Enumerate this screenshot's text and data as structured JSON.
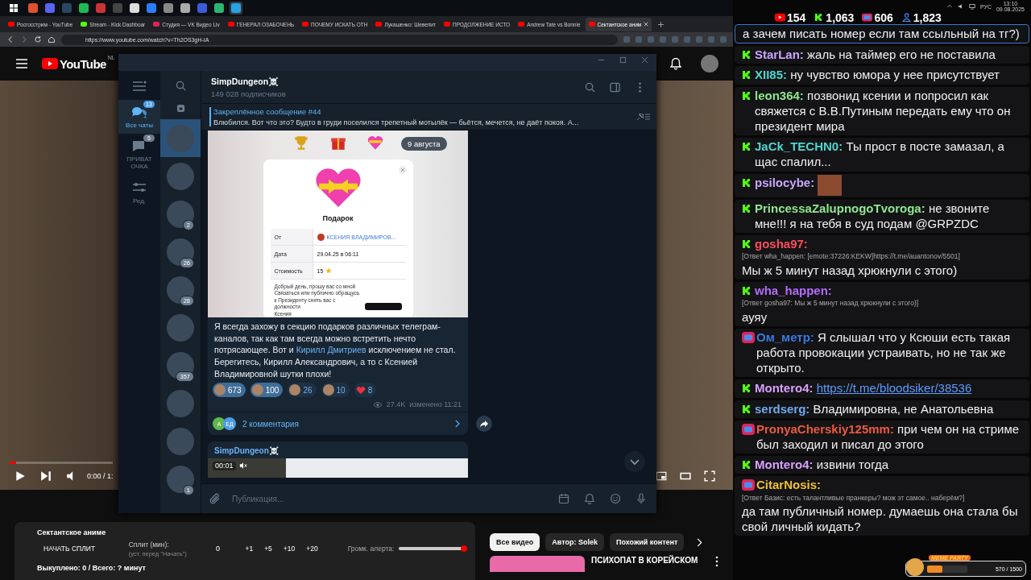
{
  "system_tray": {
    "language": "РУС",
    "time": "13:10",
    "date": "09.08.2025"
  },
  "browser": {
    "tabs": [
      {
        "title": "Росгосстрим - YouTube",
        "kind": "youtube",
        "selected": false
      },
      {
        "title": "Stream - Kick Dashboar",
        "kind": "kick",
        "selected": false
      },
      {
        "title": "Студия — VK Видео Liv",
        "kind": "vk",
        "selected": false
      },
      {
        "title": "ГЕНЕРАЛ ОЗАБОЧЕНЬ",
        "kind": "youtube",
        "selected": false
      },
      {
        "title": "ПОЧЕМУ ИСКАТЬ ОТН",
        "kind": "youtube",
        "selected": false
      },
      {
        "title": "Лукашенко: Шевелит",
        "kind": "youtube",
        "selected": false
      },
      {
        "title": "ПРОДОЛЖЕНИЕ ИСТО",
        "kind": "youtube",
        "selected": false
      },
      {
        "title": "Andrew Tate vs Bonnie",
        "kind": "youtube",
        "selected": false
      },
      {
        "title": "Сектантское аним",
        "kind": "youtube",
        "selected": true
      }
    ],
    "url": "https://www.youtube.com/watch?v=Th2OS3gH-IA"
  },
  "youtube": {
    "logo": "YouTube",
    "region": "NL",
    "video_time": "0:00 / 1:",
    "progress": {
      "level": 0.06
    },
    "chips": [
      {
        "label": "Все видео",
        "selected": true
      },
      {
        "label": "Автор: Solek",
        "selected": false
      },
      {
        "label": "Похожий контент",
        "selected": false
      }
    ],
    "recommended_title": "ПСИХОПАТ В КОРЕЙСКОМ"
  },
  "split_panel": {
    "title": "Сектантское аниме",
    "start_button": "НАЧАТЬ СПЛИТ",
    "split_label": "Сплит (мин):",
    "split_hint": "(уст. перед \"Начать\")",
    "split_value": "0",
    "increments": [
      "+1",
      "+5",
      "+10",
      "+20"
    ],
    "alert_label": "Громк. алерта:",
    "alert_volume": {
      "level": 0.95
    },
    "totals": "Выкуплено: 0 / Всего: ? минут"
  },
  "telegram": {
    "folders": [
      {
        "label": "Все чаты",
        "badge": "13",
        "kind": "chats",
        "selected": true
      },
      {
        "label": "ПРИВАТ ОЧКА",
        "badge": "5",
        "kind": "folder",
        "selected": false
      },
      {
        "label": "Ред.",
        "kind": "edit",
        "selected": false
      }
    ],
    "chats": [
      {
        "selected": true
      },
      {
        "selected": false
      },
      {
        "badge": "2",
        "selected": false
      },
      {
        "badge": "26",
        "selected": false
      },
      {
        "badge": "28",
        "selected": false
      },
      {
        "selected": false
      },
      {
        "badge": "357",
        "selected": false
      },
      {
        "selected": false
      },
      {
        "selected": false
      },
      {
        "badge": "1",
        "selected": false
      }
    ],
    "channel": {
      "name": "SimpDungeon☠️",
      "subscribers": "149 028 подписчиков"
    },
    "pinned": {
      "title": "Закреплённое сообщение #44",
      "text": "Влюбился.   Вот что это? Будто в груди поселился трепетный мотылёк — бьётся, мечется, не даёт покоя. А..."
    },
    "date": "9 августа",
    "gift": {
      "title": "Подарок",
      "rows": [
        {
          "label": "От",
          "value": "КСЕНИЯ ВЛАДИМИРОВ...",
          "kind": "user"
        },
        {
          "label": "Дата",
          "value": "29.04.25 в 06:11",
          "kind": "text"
        },
        {
          "label": "Стоимость",
          "value": "15",
          "kind": "stars"
        }
      ],
      "note": "Добрый день, прошу вас со мной Связаться или публично обращусь к Президенту снять вас с должности",
      "signature": "Ксения"
    },
    "post": {
      "text_before": "Я всегда захожу в секцию подарков различных телеграм-каналов, так как там всегда можно встретить нечто потрясающее. Вот и ",
      "link": "Кирилл Дмитриев",
      "text_after": " исключением не стал. Берегитесь, Кирилл Александрович, а то с Ксенией Владимировной шутки плохи!",
      "reactions": [
        {
          "count": "673",
          "kind": "emoji",
          "selected": true
        },
        {
          "count": "100",
          "kind": "emoji",
          "selected": true
        },
        {
          "count": "26",
          "kind": "emoji",
          "selected": false
        },
        {
          "count": "10",
          "kind": "emoji",
          "selected": false
        },
        {
          "count": "8",
          "kind": "heart",
          "selected": false
        }
      ],
      "views": "27.4K",
      "edited": "изменено 11:21",
      "commenters": [
        "А",
        "ЕД"
      ],
      "comments": "2 комментария"
    },
    "next_post": {
      "author": "SimpDungeon☠️",
      "video_time": "00:01"
    },
    "input_placeholder": "Публикация..."
  },
  "chat": {
    "counters": [
      {
        "kind": "youtube",
        "value": "154"
      },
      {
        "kind": "kick",
        "value": "1,063"
      },
      {
        "kind": "vk",
        "value": "606"
      },
      {
        "kind": "viewers",
        "value": "1,823"
      }
    ],
    "messages": [
      {
        "kind": "none",
        "highlighted": true,
        "text": "а зачем писать номер если там ссыльный на тг?)"
      },
      {
        "kind": "kick",
        "highlighted": false,
        "author": "StarLan:",
        "color": "#c9a6ff",
        "text": "жаль на таймер его не поставила"
      },
      {
        "kind": "kick",
        "highlighted": false,
        "author": "XII85:",
        "color": "#4fd6d0",
        "text": "ну чувство юмора у нее присутствует"
      },
      {
        "kind": "kick",
        "highlighted": false,
        "author": "leon364:",
        "color": "#8ee88e",
        "text": "позвонид ксении и попросил как свяжется с В.В.Путиным передать ему что он президент мира"
      },
      {
        "kind": "kick",
        "highlighted": false,
        "author": "JaCk_TECHN0:",
        "color": "#4fd6d0",
        "text": "Ты прост в посте замазал, а щас спалил..."
      },
      {
        "kind": "kick",
        "highlighted": false,
        "author": "psilocybe:",
        "color": "#c9a6ff",
        "emote": true
      },
      {
        "kind": "kick",
        "highlighted": false,
        "author": "PrincessaZalupnogoTvoroga:",
        "color": "#8ee88e",
        "text": "не звоните мне!!! я на тебя в суд подам @GRPZDC"
      },
      {
        "kind": "kick",
        "highlighted": false,
        "author": "gosha97:",
        "color": "#ff4d5a",
        "reply": "[Ответ wha_happen: [emote:37226:KEKW]https://t.me/auantonov/5501]",
        "text": "Мы ж 5 минут назад хрюкнули с этого)"
      },
      {
        "kind": "kick",
        "highlighted": false,
        "author": "wha_happen:",
        "color": "#b46bff",
        "reply": "[Ответ gosha97: Мы ж 5 минут назад хрюкнули с этого)]",
        "text": "ауяу"
      },
      {
        "kind": "vk",
        "highlighted": false,
        "author": "Ом_метр:",
        "color": "#3a78e0",
        "text": "Я слышал что у Ксюши есть такая работа провокации устраивать, но не так же открыто."
      },
      {
        "kind": "kick",
        "highlighted": false,
        "author": "Montero4:",
        "color": "#d9a0ff",
        "link": "https://t.me/bloodsiker/38536"
      },
      {
        "kind": "kick",
        "highlighted": false,
        "author": "serdserg:",
        "color": "#6fa8ee",
        "text": "Владимировна, не Анатольевна"
      },
      {
        "kind": "vk",
        "highlighted": false,
        "author": "PronyaCherskiy125mm:",
        "color": "#ee5a3c",
        "text": "при чем он на стриме был заходил и писал до этого"
      },
      {
        "kind": "kick",
        "highlighted": false,
        "author": "Montero4:",
        "color": "#d9a0ff",
        "text": "извини тогда"
      },
      {
        "kind": "vk",
        "highlighted": false,
        "author": "CitarNosis:",
        "color": "#f2c230",
        "reply": "[Ответ Базис: есть талантливые пранкеры? мож эт самое.. наберём?]",
        "text": "да там публичный номер. думаешь она стала бы свой личный кидать?"
      }
    ],
    "meme_party": {
      "title": "MEME PARTY",
      "progress": "570 / 1500",
      "level": 0.38
    }
  }
}
